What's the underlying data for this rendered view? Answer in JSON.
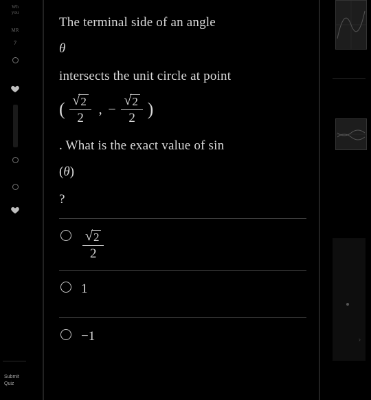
{
  "left": {
    "wh_top": "Wh",
    "wh_sub": "you",
    "mr": "MR",
    "qnum": "7",
    "submit_line1": "Submit",
    "submit_line2": "Quiz"
  },
  "question": {
    "line1": "The terminal side of an angle",
    "theta": "θ",
    "line2": "intersects the unit circle at point",
    "paren_open": "(",
    "paren_close": ")",
    "comma": ",",
    "minus": "−",
    "sqrt_rad": "2",
    "frac_den": "2",
    "line3": ". What is the exact value of sin",
    "paren_theta_open": "(",
    "paren_theta_close": ")",
    "qmark": "?"
  },
  "answers": {
    "a1_rad": "2",
    "a1_den": "2",
    "a2": "1",
    "a3": "−1"
  }
}
